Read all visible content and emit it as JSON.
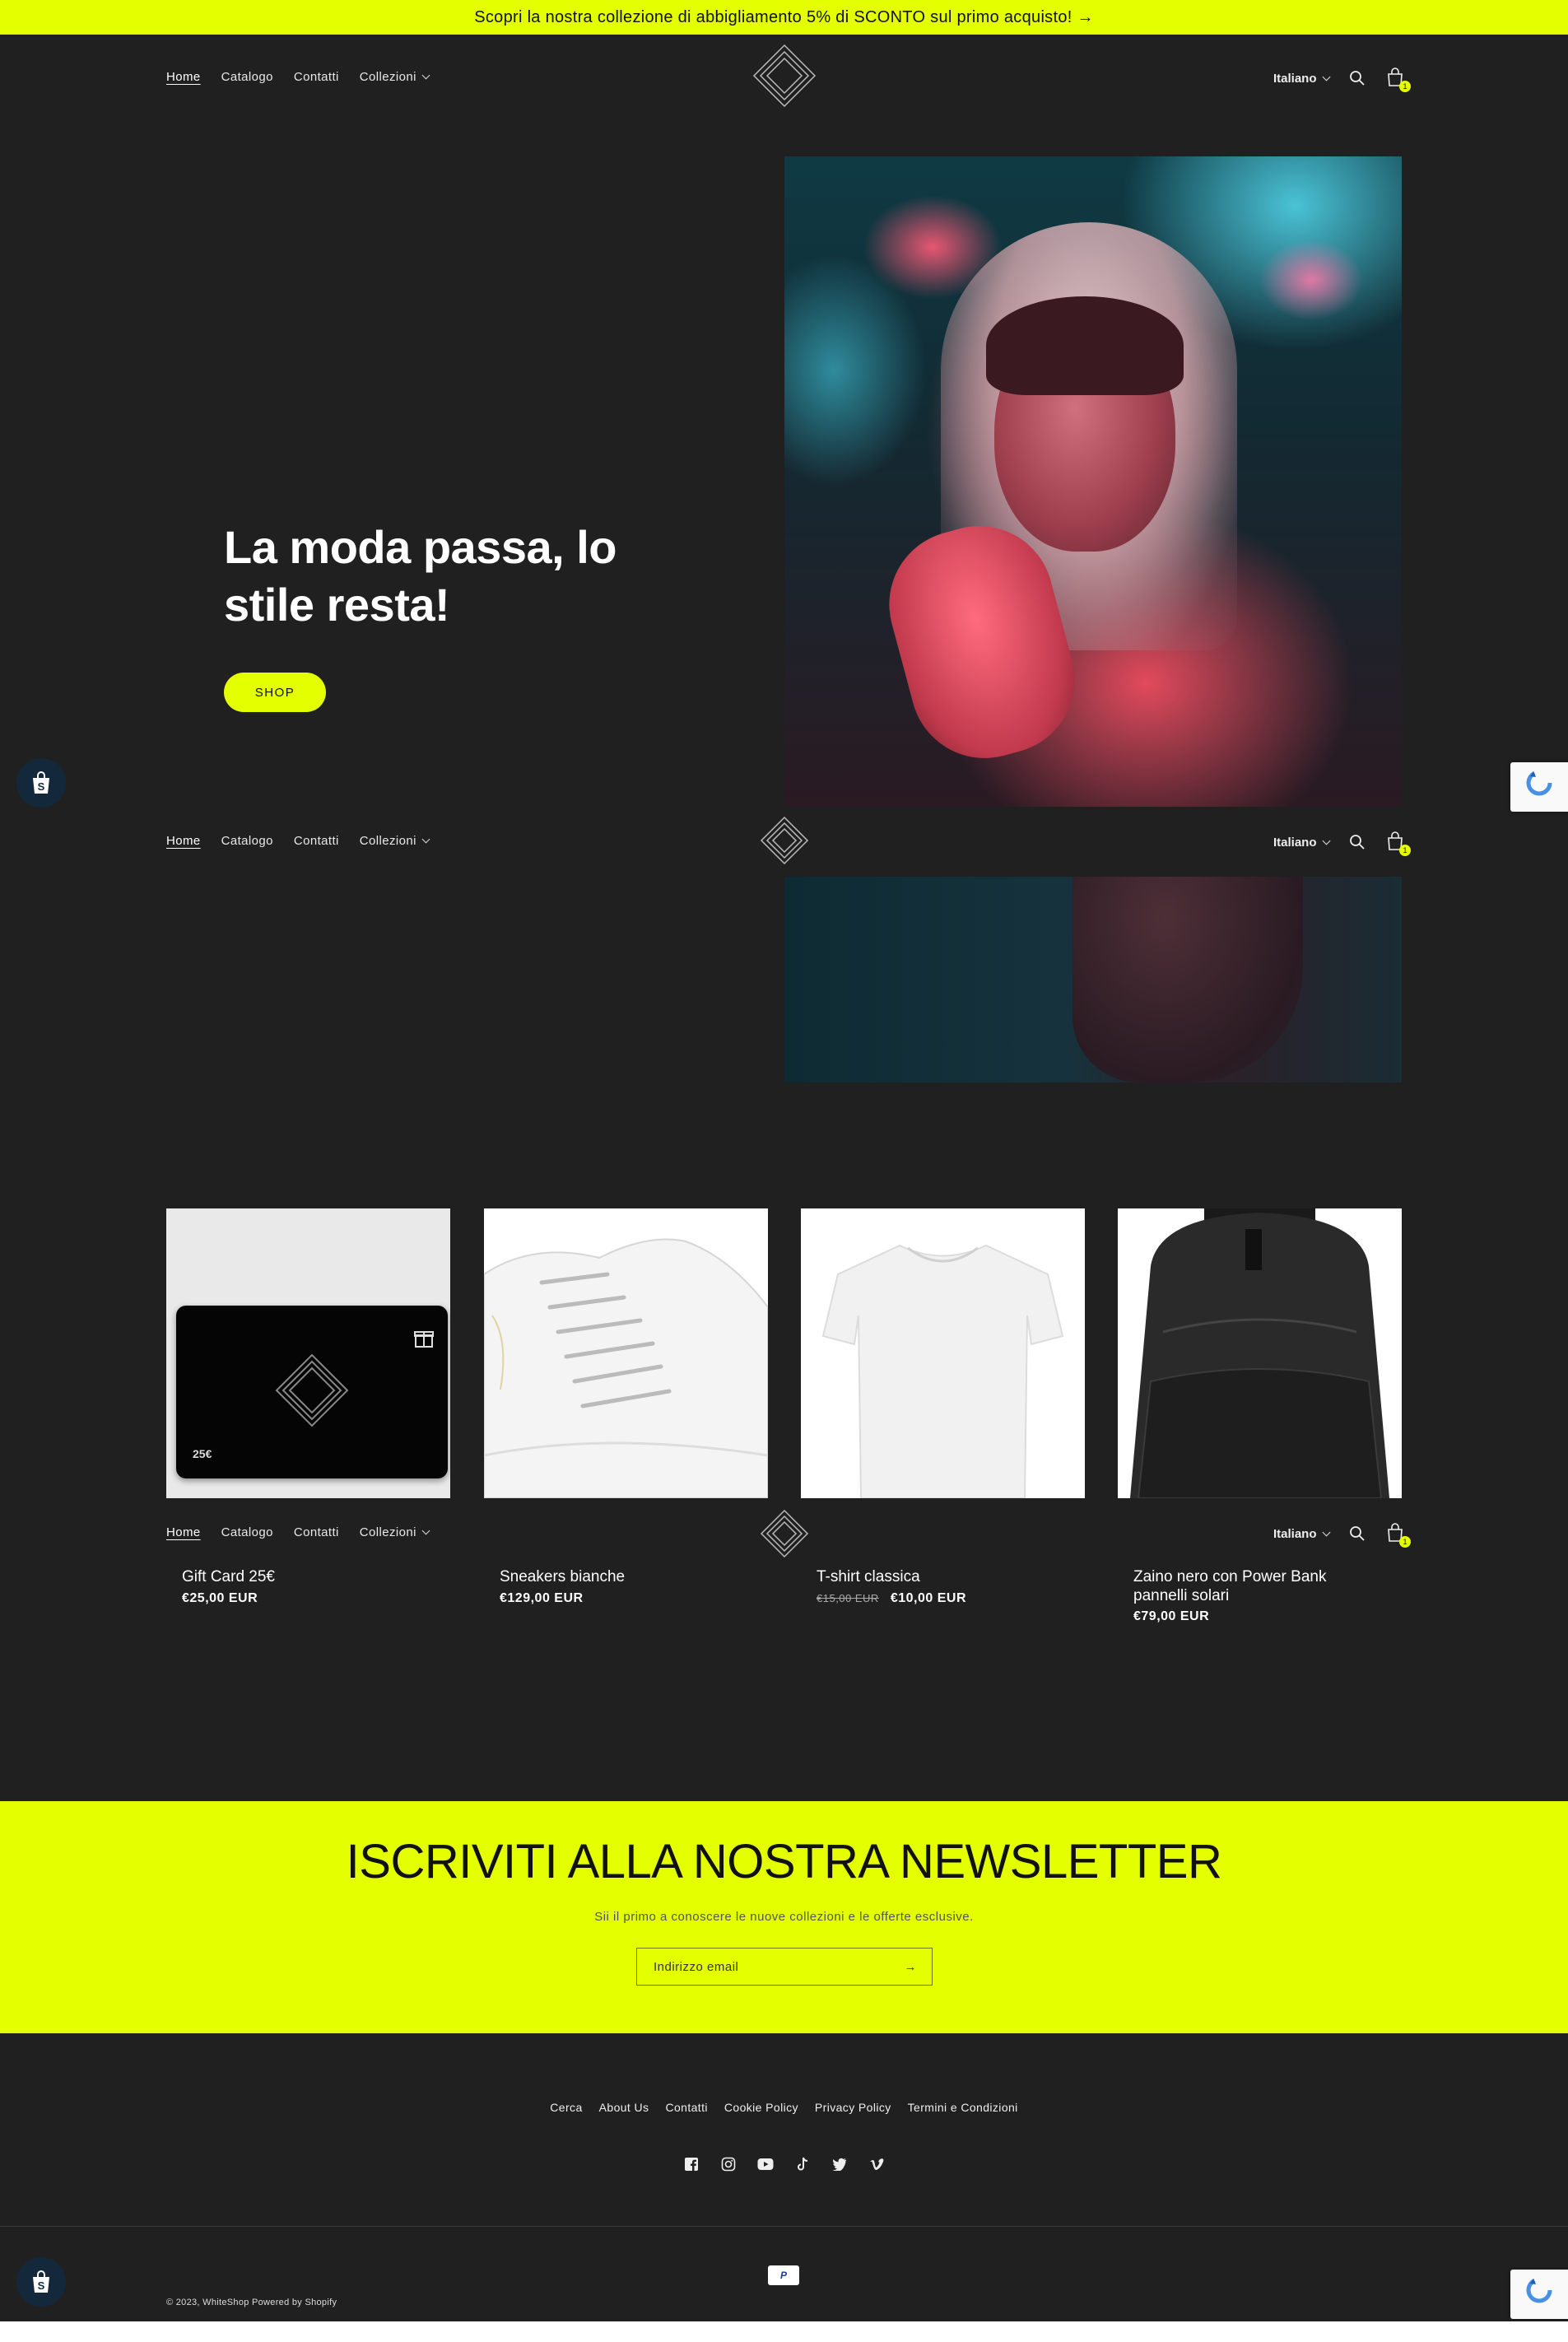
{
  "announcement": "Scopri la nostra collezione di abbigliamento 5% di SCONTO sul primo acquisto! →",
  "header": {
    "nav": [
      "Home",
      "Catalogo",
      "Contatti",
      "Collezioni"
    ],
    "language": "Italiano",
    "cart_count": "1"
  },
  "hero": {
    "title": "La moda passa, lo stile resta!",
    "button": "SHOP"
  },
  "products": [
    {
      "name": "Gift Card 25€",
      "price": "€25,00 EUR",
      "old_price": "",
      "card_label": "25€"
    },
    {
      "name": "Sneakers bianche",
      "price": "€129,00 EUR",
      "old_price": ""
    },
    {
      "name": "T-shirt classica",
      "price": "€10,00 EUR",
      "old_price": "€15,00 EUR"
    },
    {
      "name": "Zaino nero con Power Bank pannelli solari",
      "price": "€79,00 EUR",
      "old_price": ""
    }
  ],
  "newsletter": {
    "title": "ISCRIVITI ALLA NOSTRA NEWSLETTER",
    "subtitle": "Sii il primo a conoscere le nuove collezioni e le offerte esclusive.",
    "email_placeholder": "Indirizzo email",
    "submit_arrow": "→"
  },
  "footer": {
    "links": [
      "Cerca",
      "About Us",
      "Contatti",
      "Cookie Policy",
      "Privacy Policy",
      "Termini e Condizioni"
    ],
    "social_icons": [
      "facebook-icon",
      "instagram-icon",
      "youtube-icon",
      "tiktok-icon",
      "twitter-icon",
      "vimeo-icon"
    ],
    "payment": "P",
    "copyright": "© 2023, WhiteShop Powered by Shopify"
  },
  "colors": {
    "accent": "#e3ff00",
    "background": "#202020",
    "text": "#ffffff"
  }
}
